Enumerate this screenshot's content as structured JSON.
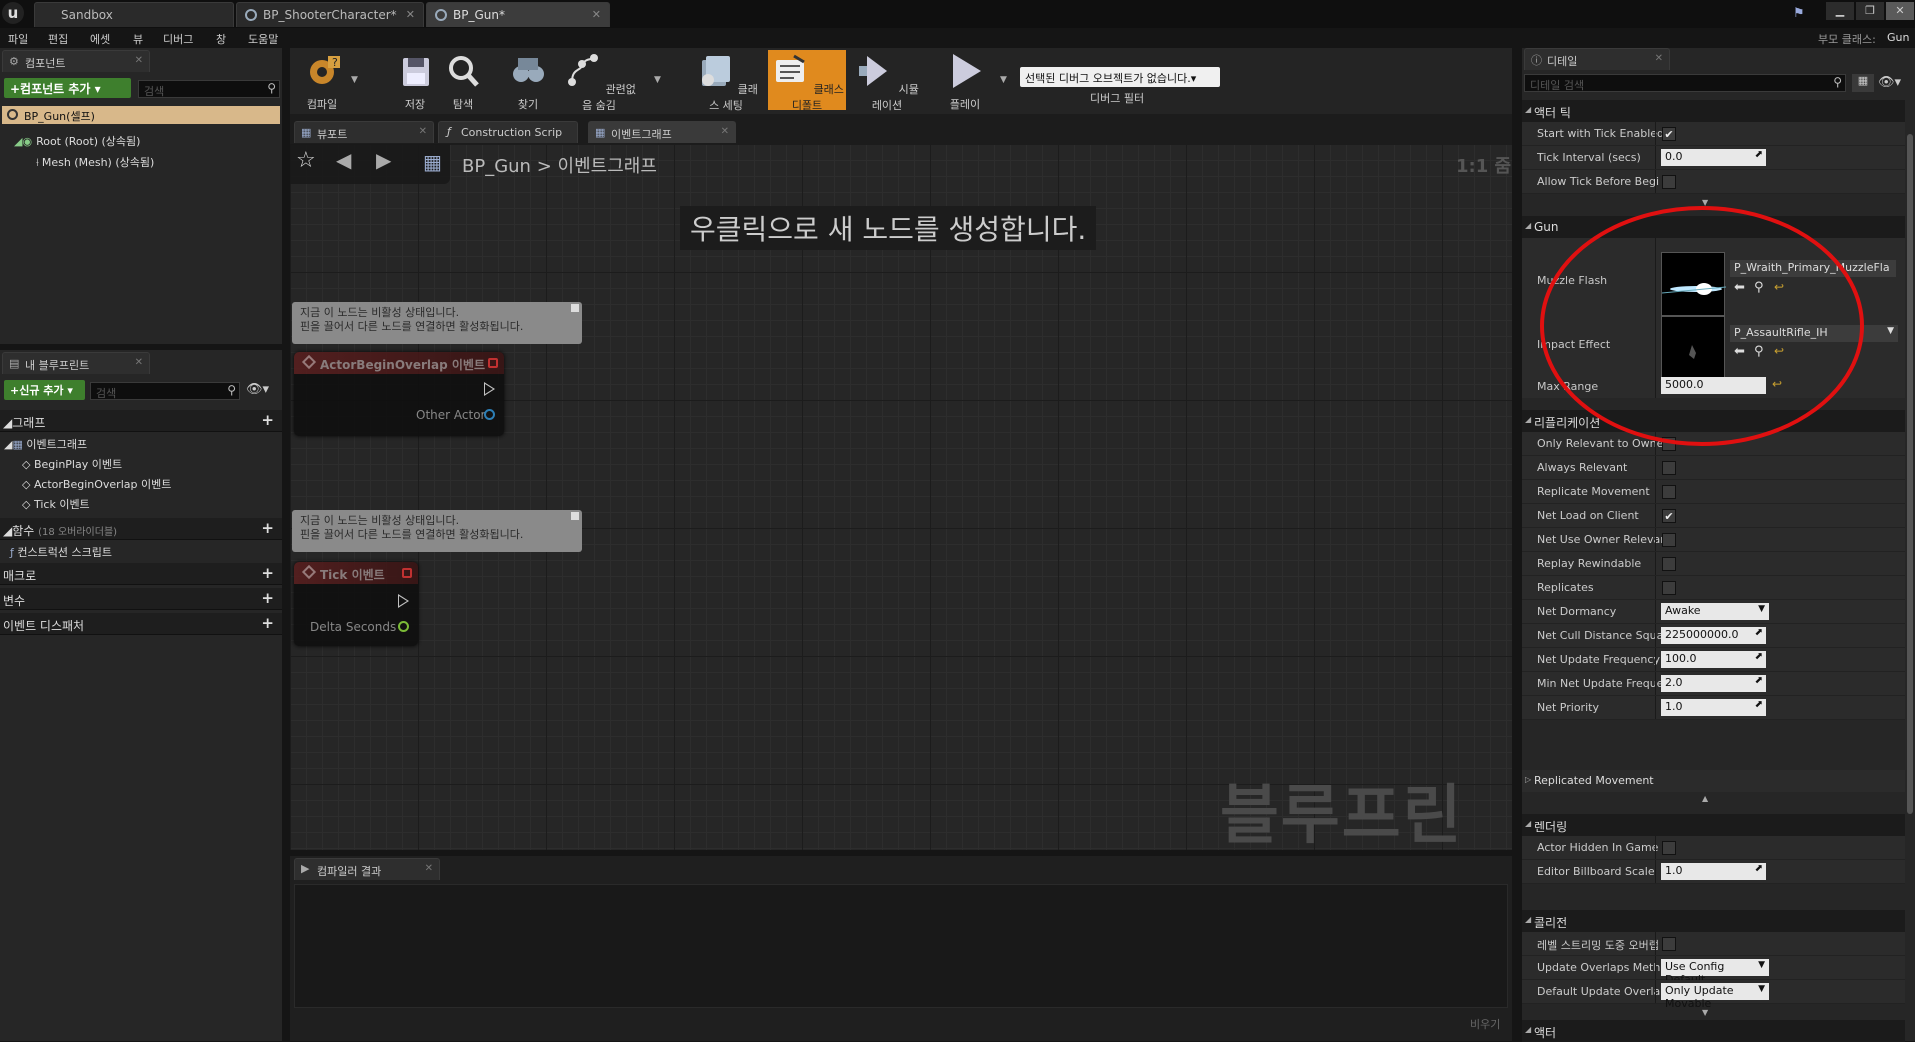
{
  "tabs": {
    "sandbox": "Sandbox",
    "shooter": "BP_ShooterCharacter*",
    "gun": "BP_Gun*"
  },
  "menu": [
    "파일",
    "편집",
    "에셋",
    "뷰",
    "디버그",
    "창",
    "도움말"
  ],
  "parent_class": {
    "label": "부모 클래스:",
    "value": "Gun"
  },
  "components": {
    "tab": "컴포넌트",
    "add_button": "+컴포넌트 추가 ▾",
    "search_placeholder": "검색",
    "self_item": "BP_Gun(셀프)",
    "items": [
      "Root (Root) (상속됨)",
      "Mesh (Mesh) (상속됨)"
    ]
  },
  "my_blueprint": {
    "tab": "내 블루프린트",
    "add_button": "+신규 추가 ▾",
    "search_placeholder": "검색",
    "graph_header": "그래프",
    "event_graph": "이벤트그래프",
    "events": [
      "BeginPlay 이벤트",
      "ActorBeginOverlap 이벤트",
      "Tick 이벤트"
    ],
    "functions_header": "함수",
    "functions_note": "(18 오버라이더블)",
    "construction": "컨스트럭션 스크립트",
    "macros": "매크로",
    "variables": "변수",
    "dispatchers": "이벤트 디스패처"
  },
  "toolbar": {
    "compile": "컴파일",
    "save": "저장",
    "browse": "탐색",
    "find": "찾기",
    "hide_unrelated": "관련없음 숨김",
    "class_settings": "클래스 세팅",
    "class_defaults": "클래스 디폴트",
    "simulation": "시뮬레이션",
    "play": "플레이",
    "debug_object": "선택된 디버그 오브젝트가 없습니다.▾",
    "debug_filter": "디버그 필터"
  },
  "editor_tabs": {
    "viewport": "뷰포트",
    "construction": "Construction Scrip",
    "event_graph": "이벤트그래프"
  },
  "graph": {
    "breadcrumb_root": "BP_Gun",
    "breadcrumb_sep": ">",
    "breadcrumb_leaf": "이벤트그래프",
    "zoom": "1:1 줌",
    "hint": "우클릭으로 새 노드를 생성합니다.",
    "watermark": "블루프린트",
    "comment_text": "지금 이 노드는 비활성 상태입니다.\n핀을 끌어서 다른 노드를 연결하면 활성화됩니다.",
    "nodes": [
      {
        "title": "ActorBeginOverlap 이벤트",
        "pin": "Other Actor",
        "pin_color": "#2f8fd0"
      },
      {
        "title": "Tick 이벤트",
        "pin": "Delta Seconds",
        "pin_color": "#8ad63a"
      }
    ]
  },
  "compiler": {
    "tab": "컴파일러 결과",
    "clear": "비우기"
  },
  "details": {
    "tab": "디테일",
    "search_placeholder": "디테일 검색",
    "sections": {
      "actor_tick": "액터 틱",
      "gun": "Gun",
      "replication": "리플리케이션",
      "rendering": "렌더링",
      "collision": "콜리전",
      "actor": "액터"
    },
    "tick": [
      {
        "label": "Start with Tick Enabled",
        "checked": true
      },
      {
        "label": "Tick Interval (secs)",
        "value": "0.0"
      },
      {
        "label": "Allow Tick Before Begi",
        "checked": false
      }
    ],
    "gun": {
      "muzzle_label": "Muzzle Flash",
      "muzzle_asset": "P_Wraith_Primary_MuzzleFla",
      "impact_label": "Impact Effect",
      "impact_asset": "P_AssaultRifle_IH",
      "range_label": "Max Range",
      "range_value": "5000.0"
    },
    "replication": [
      {
        "label": "Only Relevant to Owner",
        "checked": false
      },
      {
        "label": "Always Relevant",
        "checked": false
      },
      {
        "label": "Replicate Movement",
        "checked": false
      },
      {
        "label": "Net Load on Client",
        "checked": true
      },
      {
        "label": "Net Use Owner Relevan",
        "checked": false
      },
      {
        "label": "Replay Rewindable",
        "checked": false
      },
      {
        "label": "Replicates",
        "checked": false
      },
      {
        "label": "Net Dormancy",
        "combo": "Awake"
      },
      {
        "label": "Net Cull Distance Squa",
        "value": "225000000.0"
      },
      {
        "label": "Net Update Frequency",
        "value": "100.0"
      },
      {
        "label": "Min Net Update Freque",
        "value": "2.0"
      },
      {
        "label": "Net Priority",
        "value": "1.0"
      }
    ],
    "replicated_movement": "Replicated Movement",
    "rendering": [
      {
        "label": "Actor Hidden In Game",
        "checked": false
      },
      {
        "label": "Editor Billboard Scale",
        "value": "1.0"
      }
    ],
    "collision": [
      {
        "label": "레벨 스트리밍 도중 오버랩",
        "checked": false
      },
      {
        "label": "Update Overlaps Metho",
        "combo": "Use Config Default"
      },
      {
        "label": "Default Update Overlap",
        "combo": "Only Update Movable"
      }
    ]
  },
  "colors": {
    "highlight_ellipse": "#e01010",
    "accent_orange": "#e08a1e",
    "green": "#3e7f2d"
  }
}
